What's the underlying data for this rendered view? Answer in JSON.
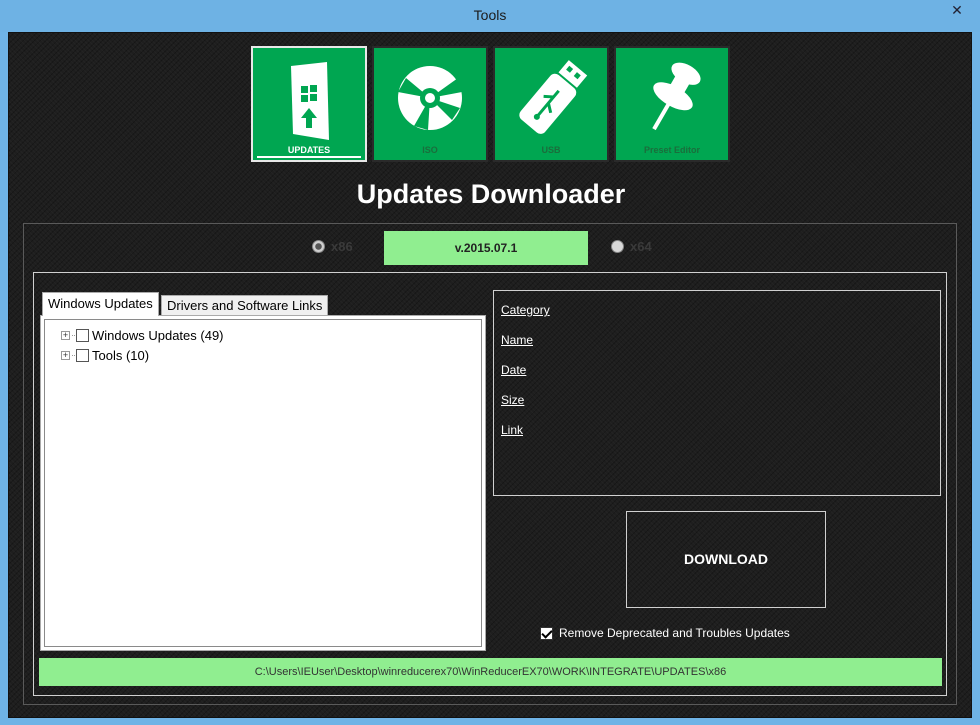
{
  "window": {
    "title": "Tools",
    "close_glyph": "✕"
  },
  "tiles": [
    {
      "label": "UPDATES",
      "icon": "windows-update-icon",
      "active": true
    },
    {
      "label": "ISO",
      "icon": "disc-icon",
      "active": false
    },
    {
      "label": "USB",
      "icon": "usb-drive-icon",
      "active": false
    },
    {
      "label": "Preset Editor",
      "icon": "pushpin-icon",
      "active": false
    }
  ],
  "heading": "Updates Downloader",
  "arch": {
    "x86": "x86",
    "x64": "x64",
    "selected": "x86"
  },
  "version": "v.2015.07.1",
  "tabs": {
    "active": "Windows Updates",
    "inactive": "Drivers and Software Links"
  },
  "tree": [
    {
      "label": "Windows Updates (49)",
      "expander": "+"
    },
    {
      "label": "Tools (10)",
      "expander": "+"
    }
  ],
  "details": {
    "category": "Category",
    "name": "Name",
    "date": "Date",
    "size": "Size",
    "link": "Link"
  },
  "download_label": "DOWNLOAD",
  "remove_deprecated": {
    "label": "Remove Deprecated and Troubles Updates",
    "checked": true
  },
  "path": "C:\\Users\\IEUser\\Desktop\\winreducerex70\\WinReducerEX70\\WORK\\INTEGRATE\\UPDATES\\x86",
  "colors": {
    "accent": "#00a651",
    "highlight": "#90ee90",
    "titlebar": "#6eb2e4"
  }
}
